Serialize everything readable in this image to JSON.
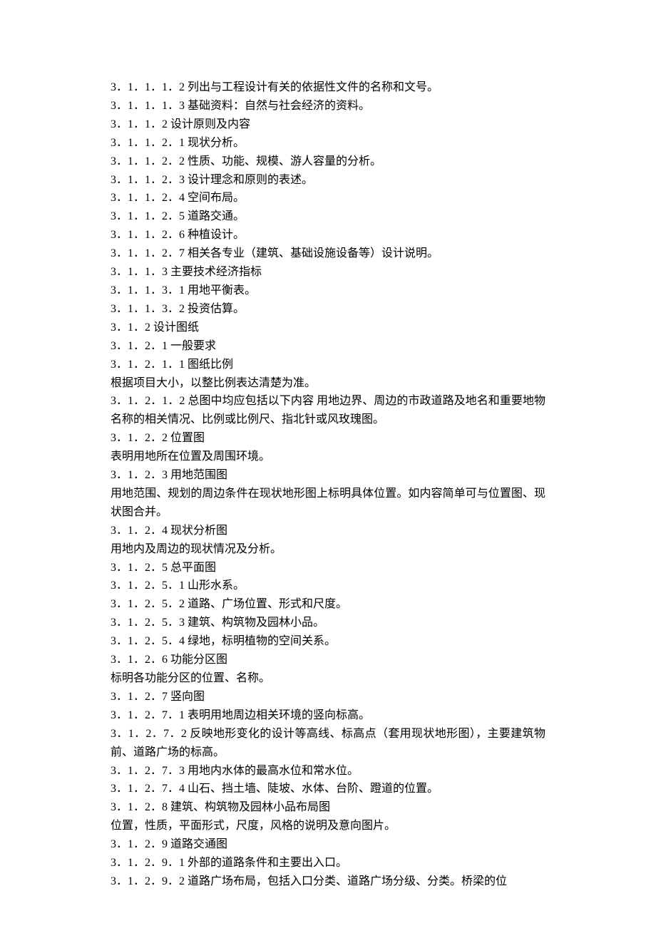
{
  "lines": [
    "3．1．1．1．2 列出与工程设计有关的依据性文件的名称和文号。",
    "3．1．1．1．3 基础资料：自然与社会经济的资料。",
    "3．1．1．2 设计原则及内容",
    "3．1．1．2．1 现状分析。",
    "3．1．1．2．2 性质、功能、规模、游人容量的分析。",
    "3．1．1．2．3 设计理念和原则的表述。",
    "3．1．1．2．4 空间布局。",
    "3．1．1．2．5 道路交通。",
    "3．1．1．2．6 种植设计。",
    "3．1．1．2．7 相关各专业（建筑、基础设施设备等）设计说明。",
    "3．1．1．3 主要技术经济指标",
    "3．1．1．3．1 用地平衡表。",
    "3．1．1．3．2 投资估算。",
    "3．1．2 设计图纸",
    "3．1．2．1 一般要求",
    "3．1．2．1．1 图纸比例",
    "根据项目大小，以整比例表达清楚为准。",
    "3．1．2．1．2 总图中均应包括以下内容 用地边界、周边的市政道路及地名和重要地物名称的相关情况、比例或比例尺、指北针或风玫瑰图。",
    "3．1．2．2 位置图",
    "表明用地所在位置及周围环境。",
    "3．1．2．3 用地范围图",
    "用地范围、规划的周边条件在现状地形图上标明具体位置。如内容简单可与位置图、现状图合并。",
    "3．1．2．4 现状分析图",
    "用地内及周边的现状情况及分析。",
    "3．1．2．5 总平面图",
    "3．1．2．5．1 山形水系。",
    "3．1．2．5．2 道路、广场位置、形式和尺度。",
    "3．1．2．5．3 建筑、构筑物及园林小品。",
    "3．1．2．5．4 绿地，标明植物的空间关系。",
    "3．1．2．6 功能分区图",
    "标明各功能分区的位置、名称。",
    "3．1．2．7 竖向图",
    "3．1．2．7．1 表明用地周边相关环境的竖向标高。",
    "3．1．2．7．2 反映地形变化的设计等高线、标高点（套用现状地形图），主要建筑物前、道路广场的标高。",
    "3．1．2．7．3 用地内水体的最高水位和常水位。",
    "3．1．2．7．4 山石、挡土墙、陡坡、水体、台阶、蹬道的位置。",
    "3．1．2．8 建筑、构筑物及园林小品布局图",
    "位置，性质，平面形式，尺度，风格的说明及意向图片。",
    "3．1．2．9 道路交通图",
    "3．1．2．9．1 外部的道路条件和主要出入口。",
    "3．1．2．9．2 道路广场布局，包括入口分类、道路广场分级、分类。桥梁的位"
  ]
}
